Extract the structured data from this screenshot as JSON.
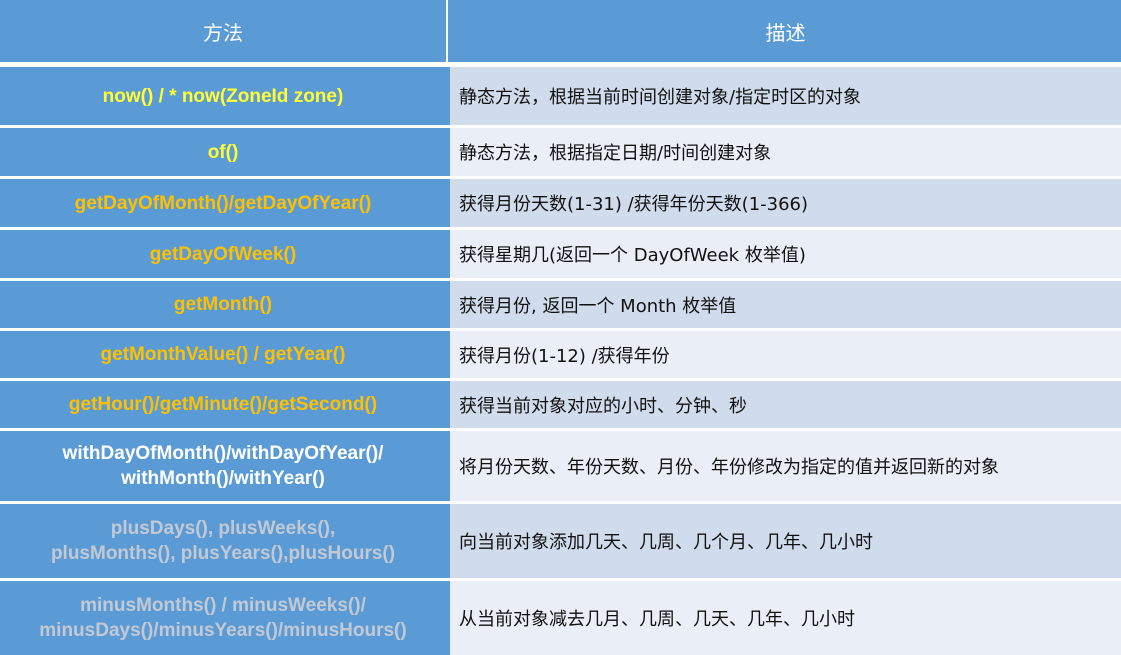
{
  "table": {
    "headers": [
      "方法",
      "描述"
    ],
    "colors": {
      "header_bg": "#5b9bd5",
      "method_cell_bg": "#5b9bd5",
      "desc_row_odd_bg": "#d0dcec",
      "desc_row_even_bg": "#e9eef7",
      "method_yellow": "#ffff33",
      "method_orange": "#ffc000",
      "method_white": "#ffffff",
      "method_gray": "#c3c9d4"
    },
    "rows": [
      {
        "method": "now() / *  now(ZoneId zone)",
        "method_color": "yellow",
        "description": "静态方法，根据当前时间创建对象/指定时区的对象"
      },
      {
        "method": "of()",
        "method_color": "yellow",
        "description": "静态方法，根据指定日期/时间创建对象"
      },
      {
        "method": "getDayOfMonth()/getDayOfYear()",
        "method_color": "orange",
        "description": "获得月份天数(1-31) /获得年份天数(1-366)"
      },
      {
        "method": "getDayOfWeek()",
        "method_color": "orange",
        "description": "获得星期几(返回一个 DayOfWeek 枚举值)"
      },
      {
        "method": "getMonth()",
        "method_color": "orange",
        "description": "获得月份, 返回一个 Month 枚举值"
      },
      {
        "method": "getMonthValue() / getYear()",
        "method_color": "orange",
        "description": "获得月份(1-12) /获得年份"
      },
      {
        "method": "getHour()/getMinute()/getSecond()",
        "method_color": "orange",
        "description": "获得当前对象对应的小时、分钟、秒"
      },
      {
        "method": "withDayOfMonth()/withDayOfYear()/\nwithMonth()/withYear()",
        "method_color": "white",
        "description": "将月份天数、年份天数、月份、年份修改为指定的值并返回新的对象"
      },
      {
        "method": "plusDays(), plusWeeks(),\nplusMonths(), plusYears(),plusHours()",
        "method_color": "gray",
        "description": "向当前对象添加几天、几周、几个月、几年、几小时"
      },
      {
        "method": "minusMonths() / minusWeeks()/\nminusDays()/minusYears()/minusHours()",
        "method_color": "gray",
        "description": "从当前对象减去几月、几周、几天、几年、几小时"
      }
    ]
  }
}
